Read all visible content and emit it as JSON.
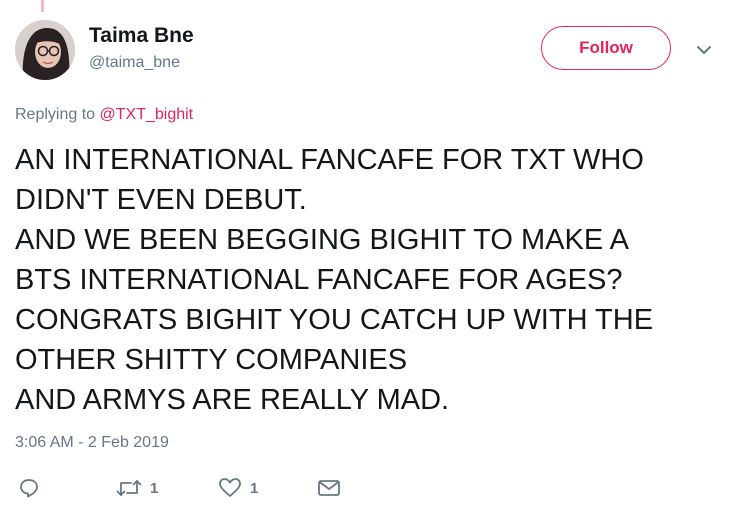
{
  "user": {
    "display_name": "Taima Bne",
    "handle": "@taima_bne"
  },
  "follow_button": {
    "label": "Follow"
  },
  "reply": {
    "prefix": "Replying to ",
    "mention": "@TXT_bighit"
  },
  "tweet": {
    "lines": [
      "AN INTERNATIONAL FANCAFE FOR TXT WHO",
      "DIDN'T EVEN DEBUT.",
      "AND WE BEEN BEGGING BIGHIT TO MAKE A",
      "BTS INTERNATIONAL FANCAFE FOR AGES?",
      "CONGRATS BIGHIT YOU CATCH UP WITH THE",
      "OTHER SHITTY COMPANIES",
      "AND ARMYS ARE REALLY MAD."
    ],
    "timestamp": "3:06 AM - 2 Feb 2019"
  },
  "actions": {
    "reply": {
      "icon": "reply-icon",
      "count": ""
    },
    "retweet": {
      "icon": "retweet-icon",
      "count": "1"
    },
    "like": {
      "icon": "heart-icon",
      "count": "1"
    },
    "dm": {
      "icon": "envelope-icon",
      "count": ""
    }
  },
  "colors": {
    "accent": "#e0245e",
    "secondary_text": "#657786",
    "primary_text": "#14171a"
  }
}
